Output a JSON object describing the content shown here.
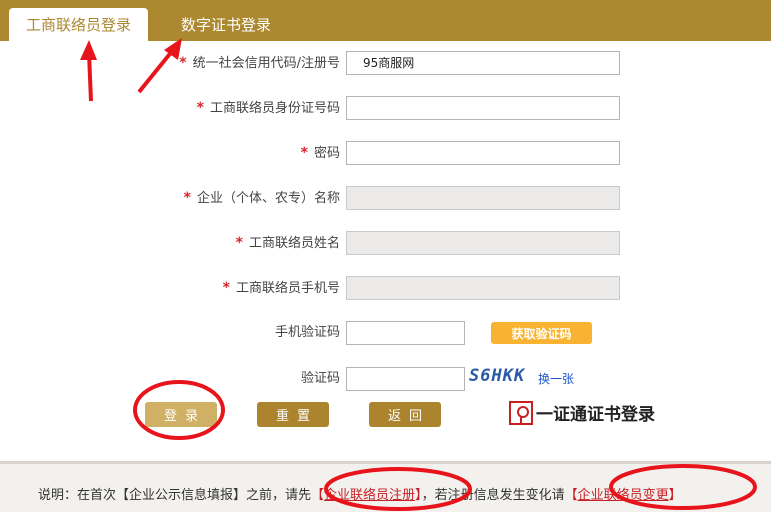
{
  "tabs": {
    "business_contact_login": "工商联络员登录",
    "digital_cert_login": "数字证书登录"
  },
  "form": {
    "credit_code": {
      "label": "统一社会信用代码/注册号",
      "required": true,
      "value": "95商服网"
    },
    "id_number": {
      "label": "工商联络员身份证号码",
      "required": true,
      "value": ""
    },
    "password": {
      "label": "密码",
      "required": true,
      "value": ""
    },
    "company_name": {
      "label": "企业（个体、农专）名称",
      "required": true,
      "value": "",
      "disabled": true
    },
    "contact_name": {
      "label": "工商联络员姓名",
      "required": true,
      "value": "",
      "disabled": true
    },
    "contact_phone": {
      "label": "工商联络员手机号",
      "required": true,
      "value": "",
      "disabled": true
    },
    "sms_code": {
      "label": "手机验证码",
      "required": false,
      "value": ""
    },
    "captcha": {
      "label": "验证码",
      "required": false,
      "value": ""
    }
  },
  "required_mark": "*",
  "sms_button": "获取验证码",
  "captcha_image_text": "S6HKK",
  "captcha_refresh": "换一张",
  "buttons": {
    "login": "登录",
    "reset": "重置",
    "back": "返回"
  },
  "cert_login_logo": "一证通证书登录",
  "footer": {
    "prefix": "说明：在首次【企业公示信息填报】之前，请先",
    "link1": "企业联络员注册",
    "middle": "，若注册信息发生变化请",
    "link2": "企业联络员变更",
    "bracket_open": "【",
    "bracket_close": "】"
  },
  "colors": {
    "brand_gold": "#ac8830",
    "required_red": "#d7262d",
    "sms_button": "#f7b331",
    "annotation_red": "#e8141b"
  }
}
